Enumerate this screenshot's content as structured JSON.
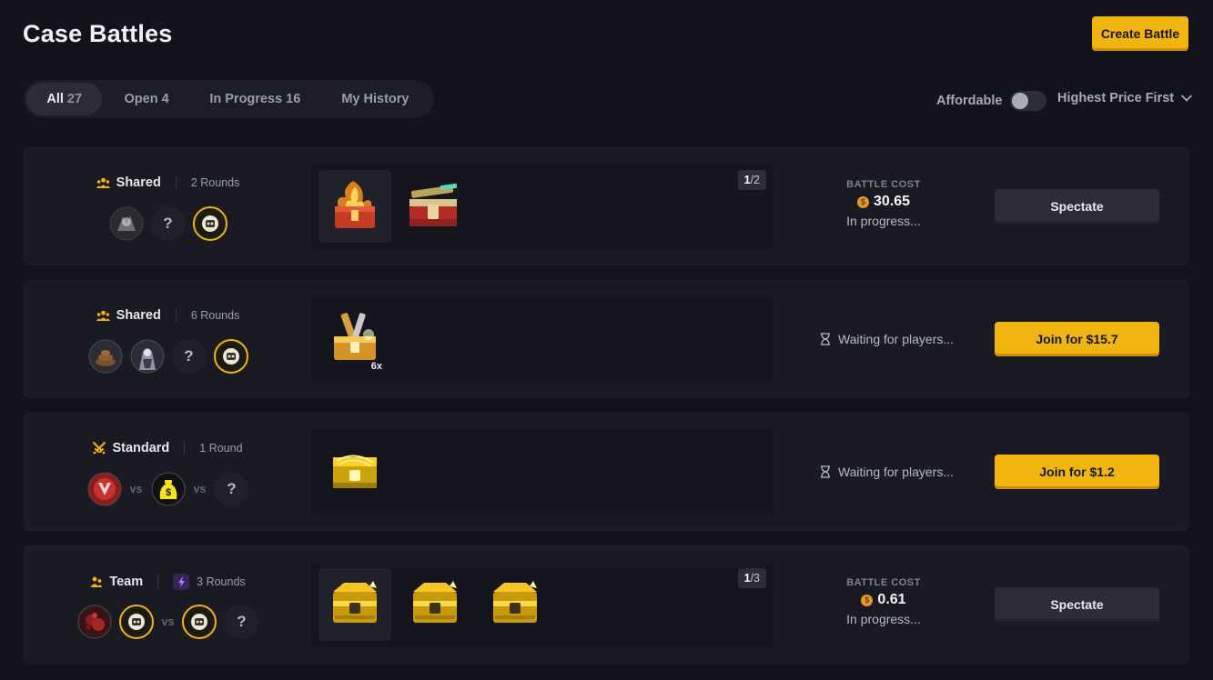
{
  "header": {
    "title": "Case Battles",
    "create_label": "Create Battle"
  },
  "tabs": [
    {
      "label": "All",
      "count": "27"
    },
    {
      "label": "Open",
      "count": "4"
    },
    {
      "label": "In Progress",
      "count": "16"
    },
    {
      "label": "My History",
      "count": ""
    }
  ],
  "filters": {
    "affordable_label": "Affordable",
    "affordable_on": false,
    "sort_label": "Highest Price First"
  },
  "battles": [
    {
      "mode": "Shared",
      "rounds": "2 Rounds",
      "players": [
        "avatar-1",
        "?",
        "avatar-bot"
      ],
      "page_current": "1",
      "page_sep": "/",
      "page_total": "2",
      "cost_label": "BATTLE COST",
      "cost_coin": "$",
      "cost": "30.65",
      "status": "In progress...",
      "action": "Spectate"
    },
    {
      "mode": "Shared",
      "rounds": "6 Rounds",
      "players": [
        "avatar-2",
        "avatar-3",
        "?",
        "avatar-bot"
      ],
      "multiplier": "6x",
      "status": "Waiting for players...",
      "action": "Join for $15.7"
    },
    {
      "mode": "Standard",
      "rounds": "1 Round",
      "players": [
        "avatar-4",
        "vs",
        "avatar-5",
        "vs",
        "?"
      ],
      "status": "Waiting for players...",
      "action": "Join for $1.2"
    },
    {
      "mode": "Team",
      "rounds": "3 Rounds",
      "players": [
        "avatar-6",
        "avatar-bot",
        "vs",
        "avatar-bot",
        "?"
      ],
      "page_current": "1",
      "page_sep": "/",
      "page_total": "3",
      "cost_label": "BATTLE COST",
      "cost_coin": "$",
      "cost": "0.61",
      "status": "In progress...",
      "action": "Spectate"
    }
  ],
  "placeholders": {
    "unknown_player": "?",
    "versus": "vs"
  },
  "colors": {
    "accent": "#f2b50f",
    "background": "#13141b",
    "card": "#191a22"
  }
}
